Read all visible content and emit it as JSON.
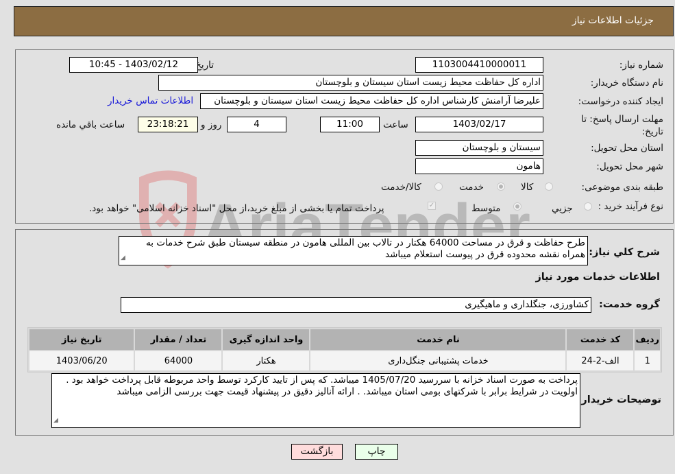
{
  "header": {
    "title": "جزئیات اطلاعات نیاز"
  },
  "fields": {
    "need_number": {
      "label": "شماره نیاز:",
      "value": "1103004410000011"
    },
    "announce_datetime": {
      "label": "تاریخ و ساعت اعلان عمومي:",
      "value": "1403/02/12 - 10:45"
    },
    "buyer_org": {
      "label": "نام دستگاه خریدار:",
      "value": "اداره کل حفاظت محیط زیست استان سیستان و بلوچستان"
    },
    "requester": {
      "label": "ایجاد کننده درخواست:",
      "value": "علیرضا آرامنش کارشناس اداره کل حفاظت محیط زیست استان سیستان و بلوچستان",
      "contact_link": "اطلاعات تماس خریدار"
    },
    "deadline": {
      "label": "مهلت ارسال پاسخ: تا تاریخ:",
      "date": "1403/02/17",
      "time_label": "ساعت",
      "time": "11:00",
      "days": "4",
      "days_label": "روز و",
      "remaining": "23:18:21",
      "remaining_label": "ساعت باقي مانده"
    },
    "province": {
      "label": "استان محل تحویل:",
      "value": "سیستان و بلوچستان"
    },
    "city": {
      "label": "شهر محل تحویل:",
      "value": "هامون"
    },
    "category": {
      "label": "طبقه بندی موضوعی:",
      "options": [
        "کالا",
        "خدمت",
        "کالا/خدمت"
      ],
      "selected": "خدمت"
    },
    "purchase_type": {
      "label": "نوع فرآیند خرید :",
      "options": [
        "جزيي",
        "متوسط"
      ],
      "selected": "متوسط",
      "treasury_checkbox_label": "پرداخت تمام یا بخشی از مبلغ خرید،از محل \"اسناد خزانه اسلامی\" خواهد بود.",
      "treasury_checked": true
    }
  },
  "description": {
    "label": "شرح كلي نياز:",
    "value": "طرح حفاظت و قرق در مساحت 64000 هکتار  در تالاب بین المللی هامون در منطقه سیستان طبق شرح خدمات به همراه نقشه محدوده  قرق در پیوست استعلام میباشد"
  },
  "services_section": {
    "title": "اطلاعات خدمات مورد نیاز"
  },
  "service_group": {
    "label": "گروه خدمت:",
    "value": "کشاورزی، جنگلداری و ماهیگیری"
  },
  "table": {
    "headers": [
      "ردیف",
      "کد خدمت",
      "نام خدمت",
      "واحد اندازه گیری",
      "تعداد / مقدار",
      "تاریخ نیاز"
    ],
    "rows": [
      [
        "1",
        "الف-2-24",
        "خدمات پشتیبانی جنگل‌داری",
        "هکتار",
        "64000",
        "1403/06/20"
      ]
    ]
  },
  "buyer_notes": {
    "label": "توضیحات خریدار:",
    "value": "پرداخت به صورت اسناد خزانه با سررسید 1405/07/20 میباشد. که پس از تایید کارکرد توسط واحد مربوطه قابل پرداخت خواهد بود . اولویت در شرایط برابر با شرکتهای بومی استان میباشد. . ارائه آنالیز دقیق در پیشنهاد قیمت جهت بررسی الزامی میباشد"
  },
  "buttons": {
    "print": "چاپ",
    "back": "بازگشت"
  },
  "watermark": {
    "text": "AriaTender.neT"
  },
  "colors": {
    "header_bg": "#8c6d42",
    "page_bg": "#e1e1e1",
    "link": "#1a1ad8",
    "print_btn_bg": "#eaffea",
    "back_btn_bg": "#ffdcdc",
    "table_header_bg": "#b3b3b3",
    "watermark_red": "#e08a8a",
    "watermark_gray": "#9a9a9a"
  }
}
